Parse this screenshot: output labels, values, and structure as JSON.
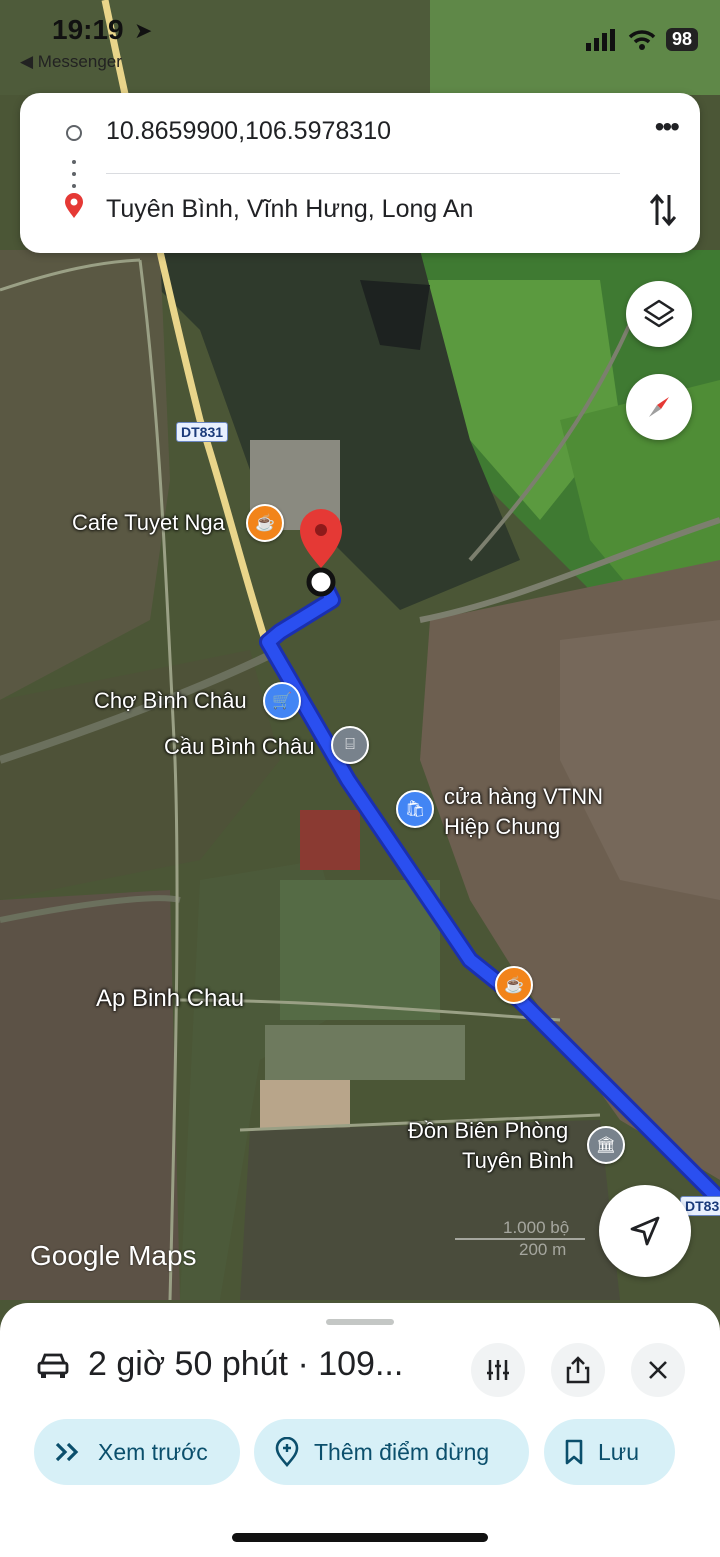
{
  "status_bar": {
    "time": "19:19",
    "back_label": "◀ Messenger",
    "battery": "98"
  },
  "directions": {
    "origin": "10.8659900,106.5978310",
    "destination": "Tuyên Bình, Vĩnh Hưng, Long An"
  },
  "map": {
    "road_shields": [
      "DT831",
      "DT83"
    ],
    "places": [
      {
        "name": "Cafe Tuyet Nga",
        "type": "cafe"
      },
      {
        "name": "Chợ Bình Châu",
        "type": "shopping"
      },
      {
        "name": "Cầu Bình Châu",
        "type": "bridge"
      },
      {
        "name": "cửa hàng VTNN",
        "name2": "Hiệp Chung",
        "type": "store"
      },
      {
        "name": "Ap Binh Chau",
        "type": "area"
      },
      {
        "name": "Đồn Biên Phòng",
        "name2": "Tuyên Bình",
        "type": "government"
      }
    ],
    "attribution": "Google Maps",
    "scale_imperial": "1.000 bộ",
    "scale_metric": "200 m"
  },
  "trip": {
    "summary": "2 giờ 50 phút · 109..."
  },
  "actions": {
    "preview": "Xem trước",
    "add_stop": "Thêm điểm dừng",
    "save": "Lưu"
  },
  "colors": {
    "route": "#2a4ff0",
    "chip_bg": "#d7f0f7",
    "chip_text": "#0b4f6c",
    "pin": "#e53935"
  }
}
